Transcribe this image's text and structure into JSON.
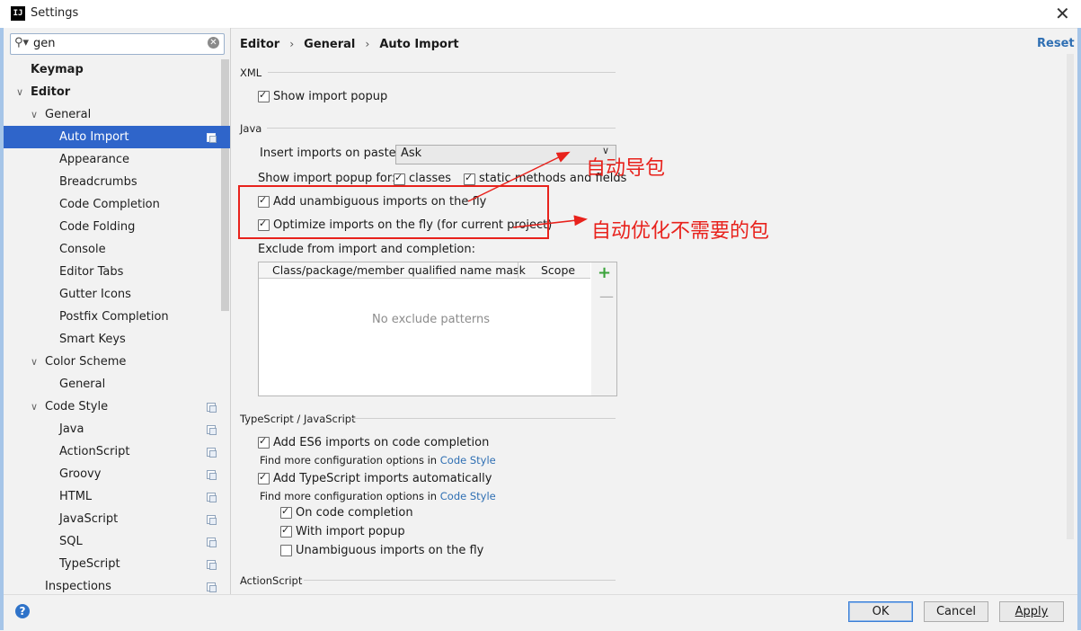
{
  "window": {
    "app_icon_text": "IJ",
    "title": "Settings",
    "close_glyph": "✕"
  },
  "search": {
    "value": "gen",
    "clear_glyph": "✕",
    "icon_glyph": "⚲▾"
  },
  "sidebar": {
    "items": [
      {
        "label": "Keymap"
      },
      {
        "label": "Editor"
      },
      {
        "label": "General"
      },
      {
        "label": "Auto Import"
      },
      {
        "label": "Appearance"
      },
      {
        "label": "Breadcrumbs"
      },
      {
        "label": "Code Completion"
      },
      {
        "label": "Code Folding"
      },
      {
        "label": "Console"
      },
      {
        "label": "Editor Tabs"
      },
      {
        "label": "Gutter Icons"
      },
      {
        "label": "Postfix Completion"
      },
      {
        "label": "Smart Keys"
      },
      {
        "label": "Color Scheme"
      },
      {
        "label": "General"
      },
      {
        "label": "Code Style"
      },
      {
        "label": "Java"
      },
      {
        "label": "ActionScript"
      },
      {
        "label": "Groovy"
      },
      {
        "label": "HTML"
      },
      {
        "label": "JavaScript"
      },
      {
        "label": "SQL"
      },
      {
        "label": "TypeScript"
      },
      {
        "label": "Inspections"
      }
    ],
    "selected": "Auto Import"
  },
  "breadcrumb": {
    "part1": "Editor",
    "part2": "General",
    "part3": "Auto Import",
    "sep": "›"
  },
  "reset_label": "Reset",
  "xml": {
    "title": "XML",
    "show_import_popup": {
      "label": "Show import popup",
      "checked": true
    }
  },
  "java": {
    "title": "Java",
    "insert_on_paste_label": "Insert imports on paste:",
    "insert_on_paste_value": "Ask",
    "show_popup_for_label": "Show import popup for:",
    "classes": {
      "label": "classes",
      "checked": true
    },
    "static_methods": {
      "label": "static methods and fields",
      "checked": true
    },
    "add_unambiguous": {
      "label": "Add unambiguous imports on the fly",
      "checked": true
    },
    "optimize_imports": {
      "label": "Optimize imports on the fly (for current project)",
      "checked": true
    },
    "exclude_label": "Exclude from import and completion:",
    "table": {
      "columns": [
        "Class/package/member qualified name mask",
        "Scope"
      ],
      "empty_text": "No exclude patterns",
      "add_glyph": "+",
      "remove_glyph": "—"
    }
  },
  "typescript": {
    "title": "TypeScript / JavaScript",
    "es6_imports": {
      "label": "Add ES6 imports on code completion",
      "checked": true
    },
    "find_more_1": "Find more configuration options in",
    "find_more_link_1": "Code Style",
    "ts_imports": {
      "label": "Add TypeScript imports automatically",
      "checked": true
    },
    "find_more_2": "Find more configuration options in",
    "find_more_link_2": "Code Style",
    "on_completion": {
      "label": "On code completion",
      "checked": true
    },
    "with_popup": {
      "label": "With import popup",
      "checked": true
    },
    "unambiguous": {
      "label": "Unambiguous imports on the fly",
      "checked": false
    }
  },
  "actionscript": {
    "title": "ActionScript"
  },
  "annotations": {
    "auto_import": "自动导包",
    "auto_optimize": "自动优化不需要的包",
    "color": "#e8221c"
  },
  "buttons": {
    "ok": "OK",
    "cancel": "Cancel",
    "apply": "Apply",
    "help": "?"
  },
  "colors": {
    "selection": "#2f65ca",
    "link": "#2f6fb3",
    "annotation_red": "#e8221c"
  }
}
